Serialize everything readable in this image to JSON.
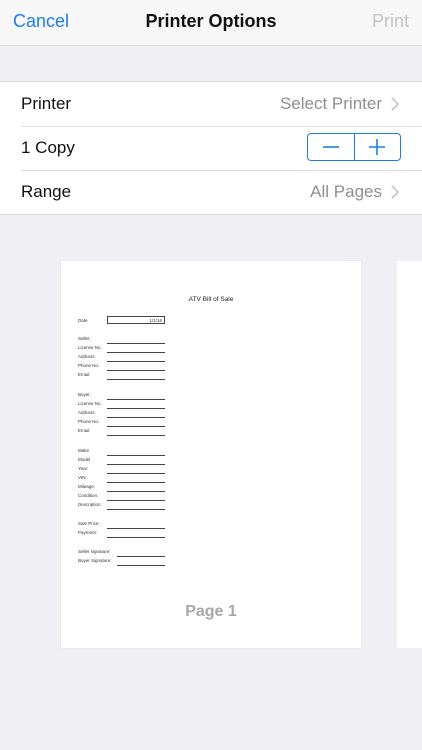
{
  "nav": {
    "cancel": "Cancel",
    "title": "Printer Options",
    "print": "Print"
  },
  "options": {
    "printer": {
      "label": "Printer",
      "value": "Select Printer"
    },
    "copies": {
      "label": "1 Copy"
    },
    "range": {
      "label": "Range",
      "value": "All Pages"
    }
  },
  "preview": {
    "doc_title": "ATV Bill of Sale",
    "date_label": "Date",
    "date_value": "1/1/16",
    "seller": [
      "Seller:",
      "License No.",
      "Address:",
      "Phone No.",
      "Email:"
    ],
    "buyer": [
      "Buyer:",
      "License No.",
      "Address:",
      "Phone No.",
      "Email:"
    ],
    "vehicle": [
      "Make",
      "Model",
      "Year:",
      "VIN:",
      "Mileage:",
      "Condition:",
      "Description:"
    ],
    "sale": [
      "Sale Price:",
      "Payment:"
    ],
    "signatures": [
      "Seller signature:",
      "Buyer Signature:"
    ],
    "page_label": "Page 1"
  },
  "colors": {
    "accent": "#1a7cf3",
    "disabled": "#c4c4c8",
    "secondary_text": "#8e8e93",
    "background": "#efeff4"
  },
  "icons": [
    "chevron-right-icon",
    "minus-icon",
    "plus-icon"
  ]
}
